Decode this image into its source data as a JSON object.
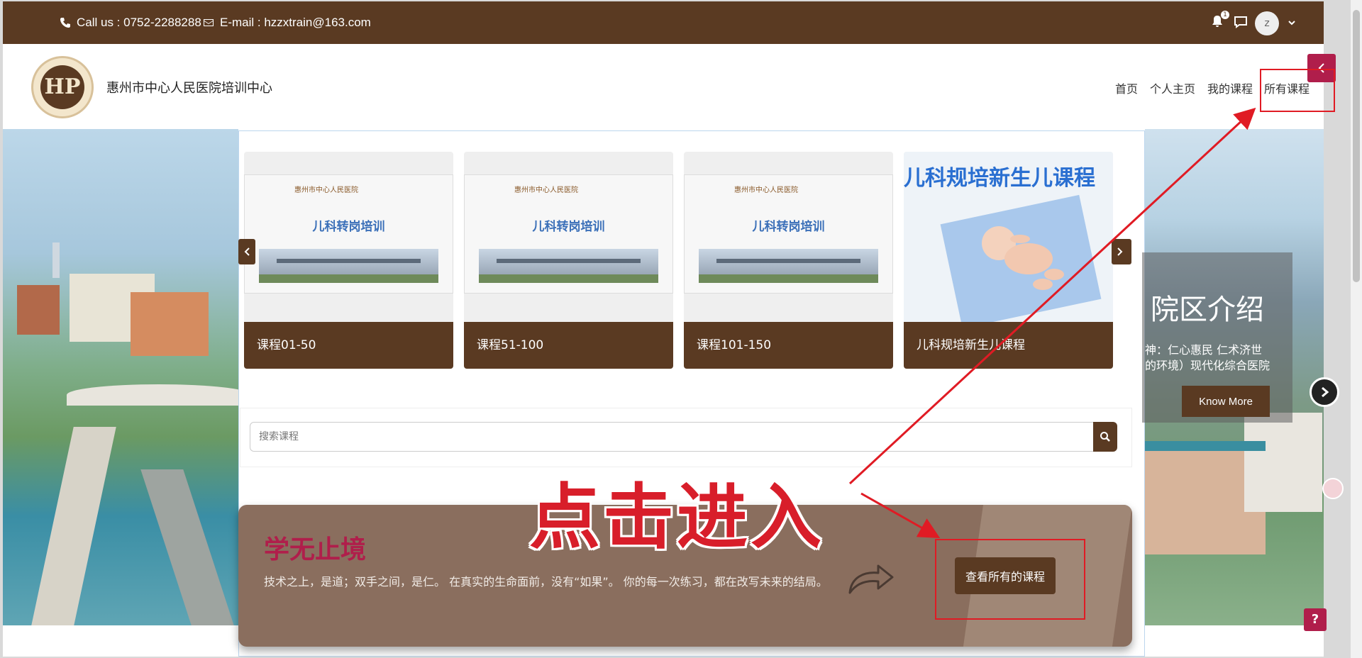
{
  "topbar": {
    "phone": "Call us : 0752-2288288",
    "email": "E-mail : hzzxtrain@163.com",
    "notification_count": "1",
    "avatar_initial": "z"
  },
  "header": {
    "logo_text": "HP",
    "site_name": "惠州市中心人民医院培训中心",
    "nav": [
      "首页",
      "个人主页",
      "我的课程",
      "所有课程"
    ]
  },
  "carousel": {
    "cards": [
      {
        "image_hospital": "惠州市中心人民医院",
        "image_title": "儿科转岗培训",
        "label": "课程01-50"
      },
      {
        "image_hospital": "惠州市中心人民医院",
        "image_title": "儿科转岗培训",
        "label": "课程51-100"
      },
      {
        "image_hospital": "惠州市中心人民医院",
        "image_title": "儿科转岗培训",
        "label": "课程101-150"
      },
      {
        "image_title": "儿科规培新生儿课程",
        "label": "儿科规培新生儿课程"
      }
    ]
  },
  "search": {
    "placeholder": "搜索课程"
  },
  "banner": {
    "title": "学无止境",
    "text": "技术之上，是道；双手之间，是仁。 在真实的生命面前，没有“如果”。 你的每一次练习，都在改写未来的结局。",
    "button": "查看所有的课程"
  },
  "annotation": {
    "text": "点击进入"
  },
  "slider": {
    "title": "院区介绍",
    "line1": "神：仁心惠民 仁术济世",
    "line2": "的环境）现代化综合医院",
    "button": "Know More"
  },
  "help": {
    "label": "?"
  },
  "colors": {
    "brand_brown": "#5a3a22",
    "accent_red": "#b01e4b",
    "annotation_red": "#e01b24"
  }
}
